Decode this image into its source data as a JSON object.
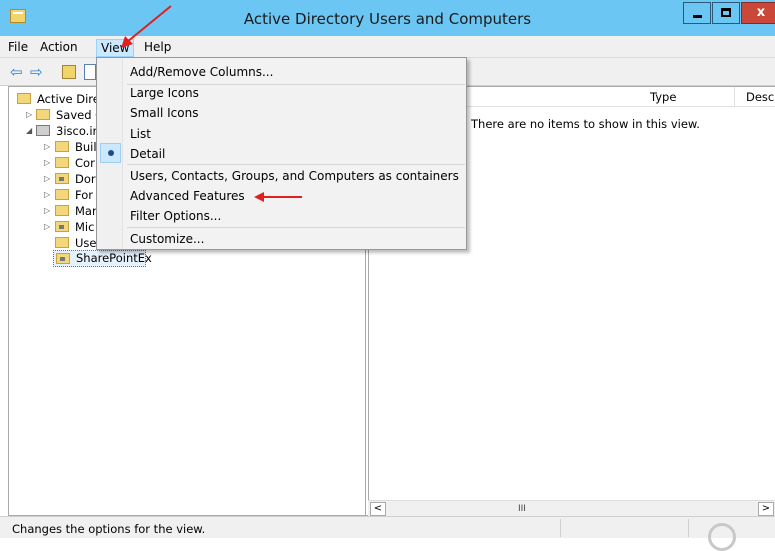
{
  "window": {
    "title": "Active Directory Users and Computers",
    "min_glyph": "_",
    "close_glyph": "x"
  },
  "menubar": {
    "file": "File",
    "action": "Action",
    "view": "View",
    "help": "Help"
  },
  "view_menu": {
    "items": [
      "Add/Remove Columns...",
      "Large Icons",
      "Small Icons",
      "List",
      "Detail",
      "Users, Contacts, Groups, and Computers as containers",
      "Advanced Features",
      "Filter Options...",
      "Customize..."
    ],
    "checked_item": "Detail"
  },
  "tree": {
    "root": "Active Dire",
    "saved": "Saved C",
    "domain": "3isco.ir",
    "children": [
      "Buil",
      "Cor",
      "Dor",
      "For",
      "Mar",
      "Mic",
      "Use"
    ],
    "selected": "SharePointEx"
  },
  "right_pane": {
    "columns": [
      "Type",
      "Descr"
    ],
    "empty_message": "There are no items to show in this view."
  },
  "scrollbar": {
    "left": "<",
    "thumb": "III",
    "right": ">"
  },
  "statusbar": {
    "text": "Changes the options for the view."
  },
  "colors": {
    "titlebar": "#6cc6f3",
    "close_button": "#c9483a",
    "menu_highlight": "#cce8ff",
    "annotation_arrow": "#e02020"
  },
  "icons": [
    "app-icon",
    "back-arrow-icon",
    "forward-arrow-icon",
    "folder-up-icon",
    "properties-icon",
    "folder-icon",
    "domain-icon",
    "radio-check-icon"
  ]
}
